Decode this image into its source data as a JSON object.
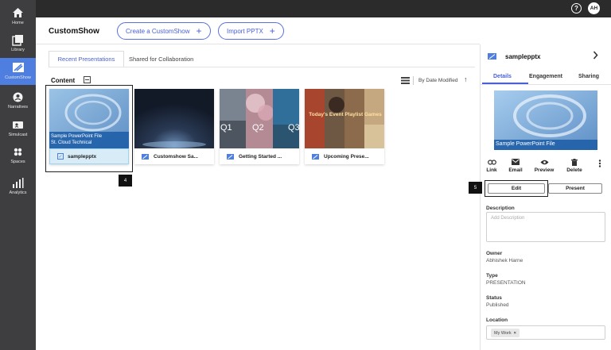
{
  "sidebar": {
    "items": [
      {
        "label": "Home",
        "icon": "home-icon"
      },
      {
        "label": "Library",
        "icon": "library-icon"
      },
      {
        "label": "CustomShow",
        "icon": "customshow-icon"
      },
      {
        "label": "Narratives",
        "icon": "narratives-icon"
      },
      {
        "label": "Simulcast",
        "icon": "simulcast-icon"
      },
      {
        "label": "Spaces",
        "icon": "spaces-icon"
      },
      {
        "label": "Analytics",
        "icon": "analytics-icon"
      }
    ],
    "active_color": "#4e7fe0",
    "bg_color": "#3e3e40"
  },
  "topbar": {
    "help_glyph": "?",
    "avatar_initials": "AH"
  },
  "header": {
    "title": "CustomShow",
    "create_label": "Create a CustomShow",
    "import_label": "Import PPTX",
    "plus": "+"
  },
  "tabs": {
    "recent": "Recent Presentations",
    "shared": "Shared for Collaboration"
  },
  "content": {
    "label": "Content",
    "sort_label": "By Date Modified",
    "sort_arrow": "↑"
  },
  "cards": [
    {
      "name": "samplepptx",
      "thumb_text_1": "Sample PowerPoint File",
      "thumb_text_2": "St. Cloud Technical",
      "selected": true
    },
    {
      "name": "Customshow Sa..."
    },
    {
      "name": "Getting Started ...",
      "thumb_text_1": "Q1",
      "thumb_text_2": "Q2",
      "thumb_text_3": "Q3"
    },
    {
      "name": "Upcoming Prese...",
      "thumb_text_1": "Today's Event Playlist Games"
    }
  ],
  "steps": {
    "card_step": "4",
    "edit_step": "5"
  },
  "panel": {
    "title": "samplepptx",
    "tabs": [
      "Details",
      "Engagement",
      "Sharing"
    ],
    "preview_caption": "Sample PowerPoint File",
    "actions": [
      "Link",
      "Email",
      "Preview",
      "Delete"
    ],
    "edit_label": "Edit",
    "present_label": "Present",
    "description_label": "Description",
    "description_placeholder": "Add Description",
    "owner_label": "Owner",
    "owner_value": "Abhishek Harne",
    "type_label": "Type",
    "type_value": "PRESENTATION",
    "status_label": "Status",
    "status_value": "Published",
    "location_label": "Location",
    "location_chip": "My Work",
    "chip_remove": "×"
  },
  "colors": {
    "accent": "#4a5fd6",
    "topbar": "#2b2b2b"
  }
}
